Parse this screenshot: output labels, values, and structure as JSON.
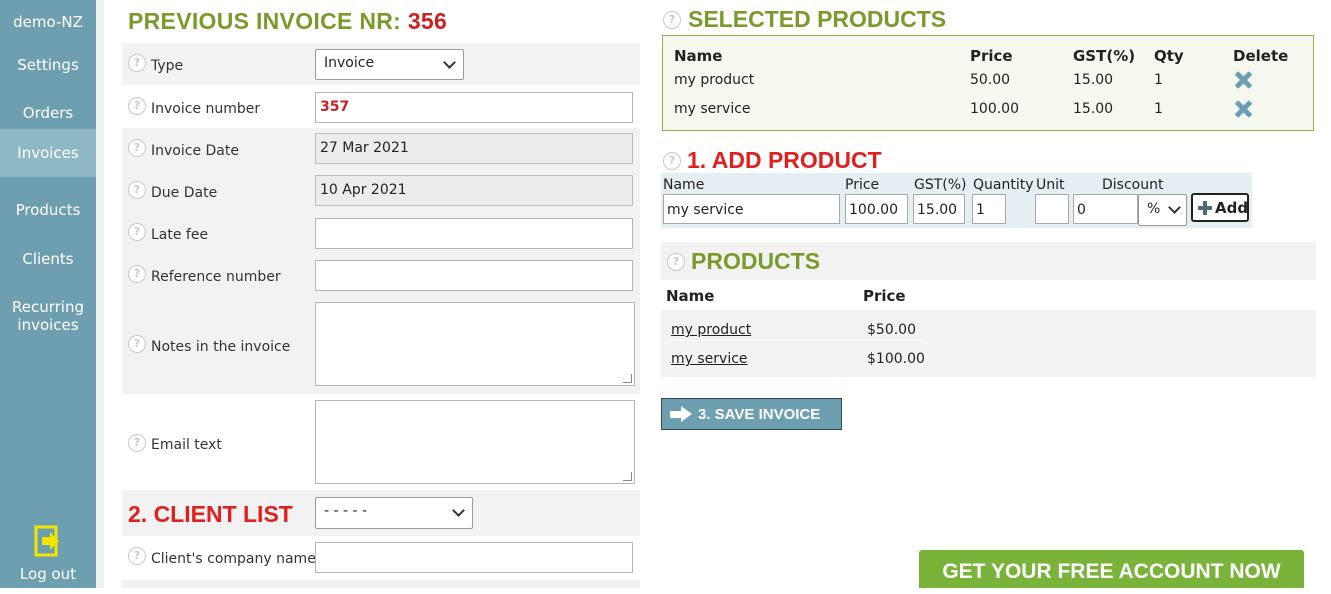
{
  "sidebar": {
    "account": "demo-NZ",
    "items": [
      {
        "label": "Settings"
      },
      {
        "label": "Orders"
      },
      {
        "label": "Invoices",
        "active": true
      },
      {
        "label": "Products"
      },
      {
        "label": "Clients"
      },
      {
        "label": "Recurring invoices"
      }
    ],
    "logout": "Log out"
  },
  "invoice_form": {
    "heading_prefix": "PREVIOUS INVOICE NR:",
    "heading_number": "356",
    "help_glyph": "?",
    "type": {
      "label": "Type",
      "value": "Invoice"
    },
    "invoice_number": {
      "label": "Invoice number",
      "value": "357"
    },
    "invoice_date": {
      "label": "Invoice Date",
      "value": "27 Mar 2021"
    },
    "due_date": {
      "label": "Due Date",
      "value": "10 Apr 2021"
    },
    "late_fee": {
      "label": "Late fee",
      "value": ""
    },
    "reference_number": {
      "label": "Reference number",
      "value": ""
    },
    "notes": {
      "label": "Notes in the invoice",
      "value": ""
    },
    "email_text": {
      "label": "Email text",
      "value": ""
    }
  },
  "client": {
    "heading": "2. CLIENT LIST",
    "select_value": "- - - - -",
    "company_name": {
      "label": "Client's company name",
      "value": ""
    }
  },
  "selected_products": {
    "heading": "SELECTED PRODUCTS",
    "columns": [
      "Name",
      "Price",
      "GST(%)",
      "Qty",
      "Delete"
    ],
    "rows": [
      {
        "name": "my product",
        "price": "50.00",
        "gst": "15.00",
        "qty": "1"
      },
      {
        "name": "my service",
        "price": "100.00",
        "gst": "15.00",
        "qty": "1"
      }
    ]
  },
  "add_product": {
    "heading": "1. ADD PRODUCT",
    "labels": {
      "name": "Name",
      "price": "Price",
      "gst": "GST(%)",
      "quantity": "Quantity",
      "unit": "Unit",
      "discount": "Discount"
    },
    "values": {
      "name": "my service",
      "price": "100.00",
      "gst": "15.00",
      "quantity": "1",
      "unit": "",
      "discount": "0",
      "discount_type": "%"
    },
    "button": "Add"
  },
  "products": {
    "heading": "PRODUCTS",
    "columns": [
      "Name",
      "Price"
    ],
    "rows": [
      {
        "name": "my product",
        "price": "$50.00"
      },
      {
        "name": "my service",
        "price": "$100.00"
      }
    ]
  },
  "save_button": "3. SAVE INVOICE",
  "cta_button": "GET YOUR FREE ACCOUNT NOW",
  "colors": {
    "sidebar": "#6e9fb1",
    "green_heading": "#7a9a2c",
    "red_heading": "#e01f1f",
    "cta": "#7ab33a"
  }
}
